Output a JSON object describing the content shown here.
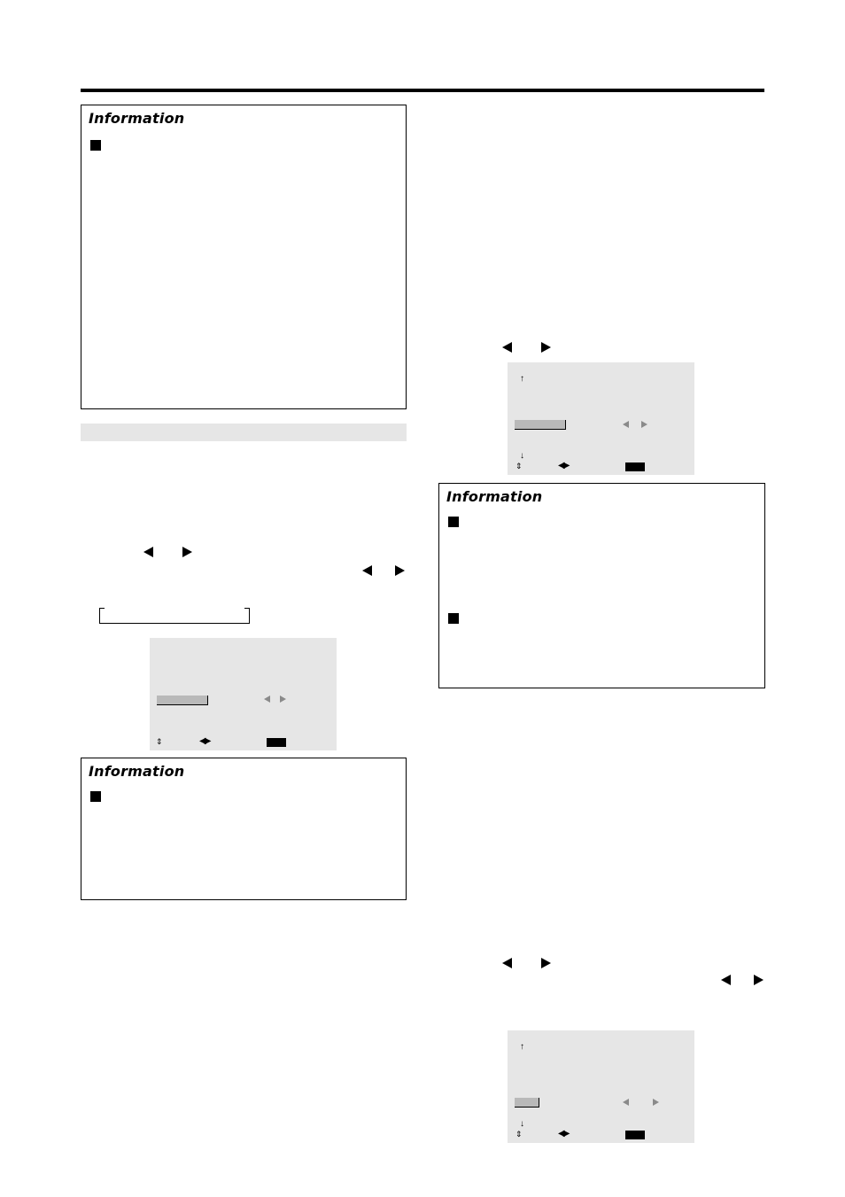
{
  "page": {
    "type": "manual-page",
    "text_visible": false
  },
  "info_boxes": [
    {
      "id": "info-1",
      "title": "Information",
      "bullet_count": 1
    },
    {
      "id": "info-2",
      "title": "Information",
      "bullet_count": 1
    },
    {
      "id": "info-3",
      "title": "Information",
      "bullet_count": 2
    }
  ],
  "icons": {
    "left_arrow": "◀",
    "right_arrow": "▶",
    "up_arrow": "🡅",
    "down_arrow": "🡇",
    "up_down": "⬍",
    "left_right": "◀▶",
    "up_arrow_glyph": "↑",
    "down_arrow_glyph": "↓",
    "updown_glyph": "⇕",
    "lr_glyph": "◀▶"
  },
  "osd_menus": [
    {
      "id": "osd-1",
      "has_up_arrow": false,
      "has_down_arrow": false
    },
    {
      "id": "osd-2",
      "has_up_arrow": true,
      "has_down_arrow": true
    },
    {
      "id": "osd-3",
      "has_up_arrow": true,
      "has_down_arrow": true
    }
  ],
  "colors": {
    "panel_gray": "#e6e6e6",
    "field_gray": "#b9b9b9",
    "arrow_gray": "#8a8a8a",
    "ink": "#000000"
  }
}
